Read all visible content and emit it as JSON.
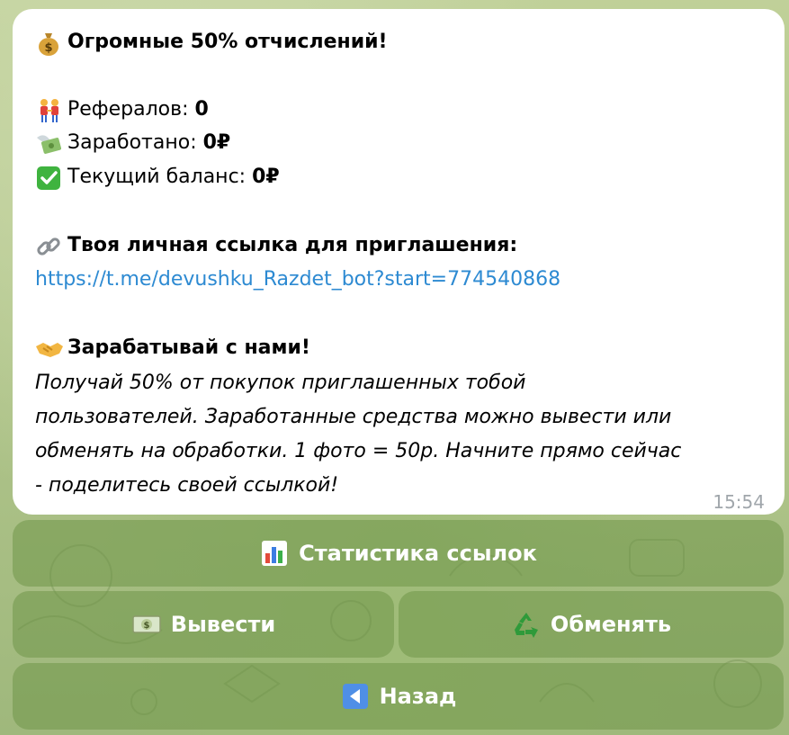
{
  "message": {
    "heading": "Огромные 50% отчислений!",
    "referrals_label": "Рефералов:",
    "referrals_value": "0",
    "earned_label": "Заработано:",
    "earned_value": "0₽",
    "balance_label": "Текущий баланс:",
    "balance_value": "0₽",
    "link_heading": "Твоя личная ссылка для приглашения:",
    "link_url": "https://t.me/devushku_Razdet_bot?start=774540868",
    "earn_heading": "Зарабатывай с нами!",
    "earn_description_1": "Получай 50% от покупок приглашенных тобой",
    "earn_description_2": "пользователей. Заработанные средства можно вывести или",
    "earn_description_3": "обменять на обработки. 1 фото = 50р. Начните прямо сейчас",
    "earn_description_4": "- поделитесь своей ссылкой!",
    "time": "15:54"
  },
  "keyboard": {
    "stats_label": "Статистика ссылок",
    "withdraw_label": "Вывести",
    "exchange_label": "Обменять",
    "back_label": "Назад"
  },
  "colors": {
    "link": "#2d8ad2",
    "button_bg": "#7a9a52",
    "time": "#a0a6ab"
  },
  "icons": {
    "heading": "money-bag-icon",
    "referrals": "people-holding-hands-icon",
    "earned": "money-with-wings-icon",
    "balance": "check-mark-button-icon",
    "link": "link-icon",
    "earn": "handshake-icon",
    "stats": "bar-chart-icon",
    "withdraw": "dollar-banknote-icon",
    "exchange": "recycle-icon",
    "back": "back-arrow-icon"
  }
}
